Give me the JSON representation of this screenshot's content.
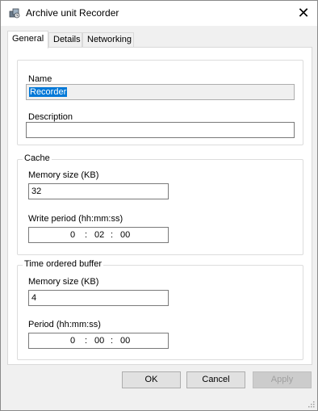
{
  "window": {
    "title": "Archive unit Recorder",
    "icon": "archive-unit-icon",
    "close_glyph": "✕"
  },
  "tabs": [
    {
      "label": "General",
      "active": true
    },
    {
      "label": "Details",
      "active": false
    },
    {
      "label": "Networking",
      "active": false
    }
  ],
  "general": {
    "name_label": "Name",
    "name_value": "Recorder",
    "description_label": "Description",
    "description_value": ""
  },
  "cache": {
    "group_label": "Cache",
    "memory_label": "Memory size (KB)",
    "memory_value": "32",
    "period_label": "Write period (hh:mm:ss)",
    "period": {
      "hh": "0",
      "mm": "02",
      "ss": "00",
      "sep": ":"
    }
  },
  "buffer": {
    "group_label": "Time ordered buffer",
    "memory_label": "Memory size (KB)",
    "memory_value": "4",
    "period_label": "Period (hh:mm:ss)",
    "period": {
      "hh": "0",
      "mm": "00",
      "ss": "00",
      "sep": ":"
    }
  },
  "buttons": {
    "ok": "OK",
    "cancel": "Cancel",
    "apply": "Apply"
  },
  "colors": {
    "selection": "#0078d7",
    "window_bg": "#f0f0f0",
    "panel_bg": "#ffffff"
  }
}
